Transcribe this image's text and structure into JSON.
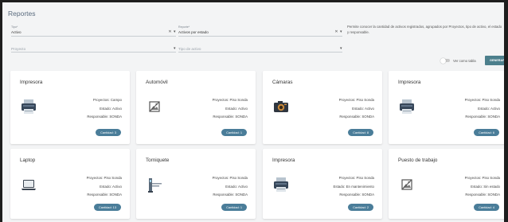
{
  "page": {
    "title": "Reportes"
  },
  "filters": {
    "tipo": {
      "label": "Tipo*",
      "value": "Activo"
    },
    "reporte": {
      "label": "Reporte*",
      "value": "Activos por estado"
    },
    "proyecto": {
      "placeholder": "Proyecto"
    },
    "tipo_activo": {
      "placeholder": "Tipo de activo"
    },
    "description": "Permite conocer la cantidad de activos registrados, agrupados por Proyectos, tipo de activo, el estado y responsable."
  },
  "controls": {
    "ver_como_tabla": "Ver como tabla",
    "ver_como_tabla_on": false,
    "generar": "GENERAR"
  },
  "cards": [
    {
      "title": "Impresora",
      "icon": "printer-icon",
      "proyecto": "Proyectos: Campo",
      "estado": "Estado: Activo",
      "responsable": "Responsable: SONDA",
      "cantidad": "Cantidad: 3"
    },
    {
      "title": "Automóvil",
      "icon": "broken-image-icon",
      "proyecto": "Proyectos: Piso Sonda",
      "estado": "Estado: Activo",
      "responsable": "Responsable: SONDA",
      "cantidad": "Cantidad: 1"
    },
    {
      "title": "Cámaras",
      "icon": "camera-icon",
      "proyecto": "Proyectos: Piso Sonda",
      "estado": "Estado: Activo",
      "responsable": "Responsable: SONDA",
      "cantidad": "Cantidad: 8"
    },
    {
      "title": "Impresora",
      "icon": "printer-icon",
      "proyecto": "Proyectos: Piso Sonda",
      "estado": "Estado: Activo",
      "responsable": "Responsable: SONDA",
      "cantidad": "Cantidad: 6"
    },
    {
      "title": "Laptop",
      "icon": "laptop-icon",
      "proyecto": "Proyectos: Piso Sonda",
      "estado": "Estado: Activo",
      "responsable": "Responsable: SONDA",
      "cantidad": "Cantidad: 13"
    },
    {
      "title": "Torniquete",
      "icon": "turnstile-icon",
      "proyecto": "Proyectos: Piso Sonda",
      "estado": "Estado: Activo",
      "responsable": "Responsable: SONDA",
      "cantidad": "Cantidad: 1"
    },
    {
      "title": "Impresora",
      "icon": "printer-icon",
      "proyecto": "Proyectos: Piso Sonda",
      "estado": "Estado: En mantenimiento",
      "responsable": "Responsable: SONDA",
      "cantidad": "Cantidad: 2"
    },
    {
      "title": "Puesto de trabajo",
      "icon": "broken-image-icon",
      "proyecto": "Proyectos: Piso Sonda",
      "estado": "Estado: Sin estado",
      "responsable": "Responsable: SONDA",
      "cantidad": "Cantidad: 4"
    }
  ]
}
